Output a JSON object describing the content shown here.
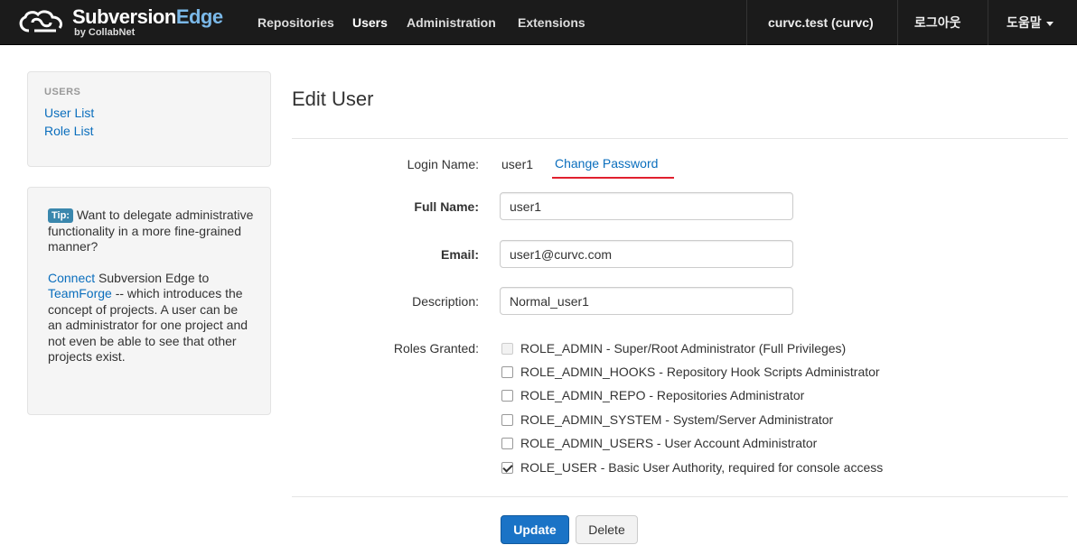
{
  "brand": {
    "name_main": "Subversion",
    "name_accent": "Edge",
    "sub": "by CollabNet"
  },
  "nav": {
    "items": [
      {
        "label": "Repositories"
      },
      {
        "label": "Users"
      },
      {
        "label": "Administration"
      },
      {
        "label": "Extensions"
      }
    ],
    "active": "Users",
    "user": "curvc.test (curvc)",
    "logout": "로그아웃",
    "help": "도움말"
  },
  "sidebar": {
    "header": "USERS",
    "links": [
      {
        "label": "User List"
      },
      {
        "label": "Role List"
      }
    ]
  },
  "tip": {
    "label": "Tip:",
    "text1": " Want to delegate administrative functionality in a more fine-grained manner?",
    "link1": "Connect",
    "text2": " Subversion Edge to ",
    "link2": "TeamForge",
    "text3": " -- which introduces the concept of projects. A user can be an administrator for one project and not even be able to see that other projects exist."
  },
  "page": {
    "title": "Edit User"
  },
  "form": {
    "login_label": "Login Name:",
    "login_value": "user1",
    "change_password": "Change Password",
    "fullname_label": "Full Name:",
    "fullname_value": "user1",
    "email_label": "Email:",
    "email_value": "user1@curvc.com",
    "description_label": "Description:",
    "description_value": "Normal_user1",
    "roles_label": "Roles Granted:",
    "roles": [
      {
        "label": "ROLE_ADMIN - Super/Root Administrator (Full Privileges)",
        "checked": false,
        "disabled": true
      },
      {
        "label": "ROLE_ADMIN_HOOKS - Repository Hook Scripts Administrator",
        "checked": false,
        "disabled": false
      },
      {
        "label": "ROLE_ADMIN_REPO - Repositories Administrator",
        "checked": false,
        "disabled": false
      },
      {
        "label": "ROLE_ADMIN_SYSTEM - System/Server Administrator",
        "checked": false,
        "disabled": false
      },
      {
        "label": "ROLE_ADMIN_USERS - User Account Administrator",
        "checked": false,
        "disabled": false
      },
      {
        "label": "ROLE_USER - Basic User Authority, required for console access",
        "checked": true,
        "disabled": false
      }
    ],
    "update_label": "Update",
    "delete_label": "Delete"
  },
  "colors": {
    "navbar": "#1b1b1b",
    "link": "#0a6ebd",
    "primary": "#1a73c6",
    "annotation": "#e0202e",
    "tip_label": "#3a87ad"
  }
}
